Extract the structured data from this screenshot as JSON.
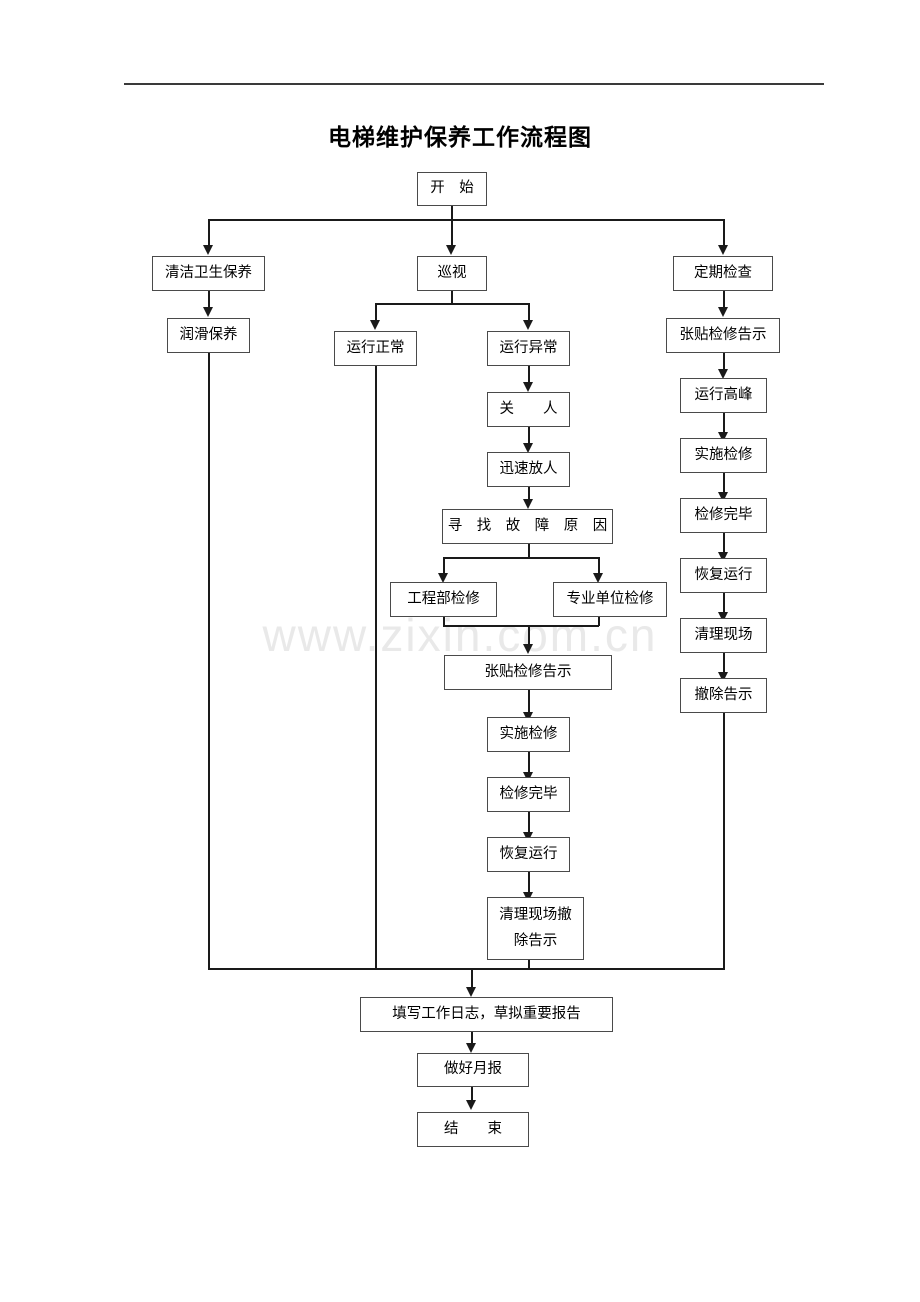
{
  "document": {
    "title": "电梯维护保养工作流程图",
    "watermark": "www.zixin.com.cn"
  },
  "flowchart": {
    "type": "flowchart",
    "orientation": "top-down",
    "nodes": {
      "start": "开　始",
      "branch_cleaning": "清洁卫生保养",
      "branch_patrol": "巡视",
      "branch_inspection": "定期检查",
      "lubrication": "润滑保养",
      "running_normal": "运行正常",
      "running_abnormal": "运行异常",
      "trapped_person": "关　　人",
      "quick_release": "迅速放人",
      "find_fault_cause": "寻　找　故　障　原　因",
      "engineering_repair": "工程部检修",
      "professional_repair": "专业单位检修",
      "post_notice_mid": "张贴检修告示",
      "implement_repair_mid": "实施检修",
      "repair_complete_mid": "检修完毕",
      "resume_operation_mid": "恢复运行",
      "clean_remove_notice_line1": "清理现场撤",
      "clean_remove_notice_line2": "除告示",
      "post_notice_right": "张贴检修告示",
      "peak_operation": "运行高峰",
      "implement_repair_right": "实施检修",
      "repair_complete_right": "检修完毕",
      "resume_operation_right": "恢复运行",
      "clean_site_right": "清理现场",
      "remove_notice_right": "撤除告示",
      "write_log": "填写工作日志，草拟重要报告",
      "monthly_report": "做好月报",
      "end": "结　　束"
    }
  }
}
